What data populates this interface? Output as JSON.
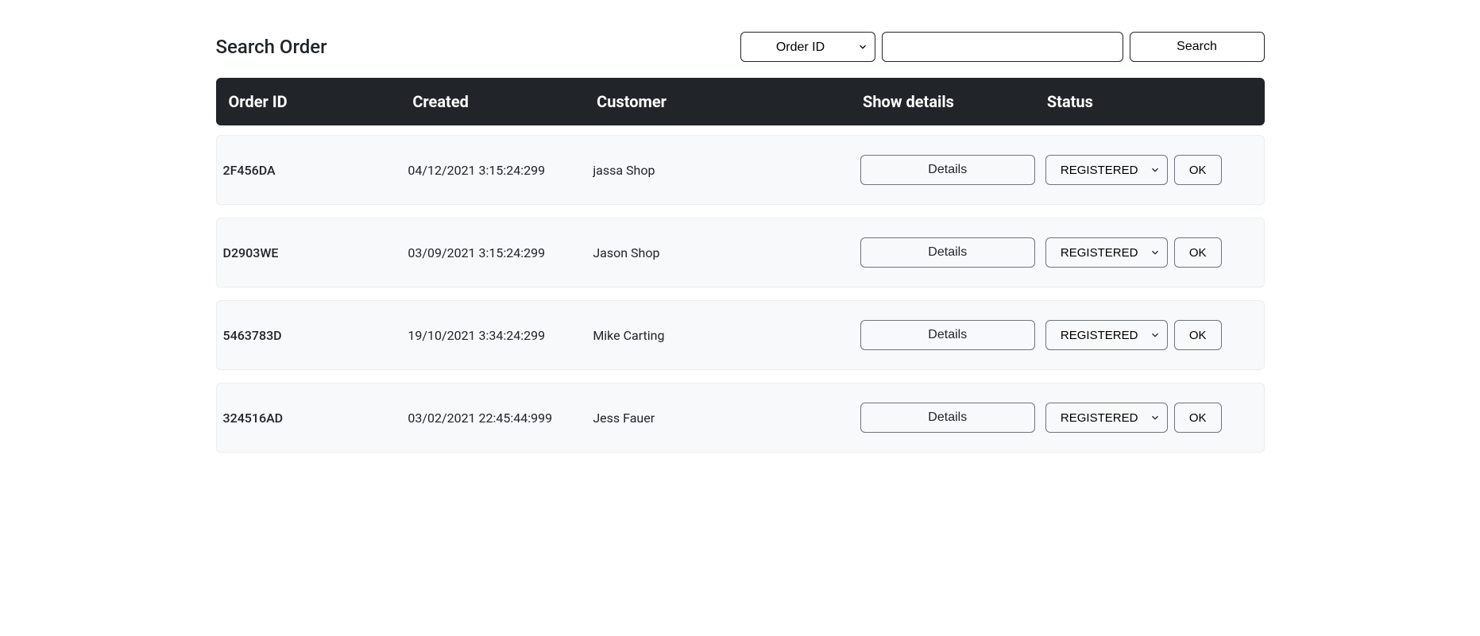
{
  "title": "Search Order",
  "search": {
    "field_option": "Order ID",
    "input_value": "",
    "button_label": "Search"
  },
  "columns": {
    "id": "Order ID",
    "created": "Created",
    "customer": "Customer",
    "details": "Show details",
    "status": "Status"
  },
  "labels": {
    "details_button": "Details",
    "ok_button": "OK"
  },
  "status_options": {
    "registered": "REGISTERED"
  },
  "orders": [
    {
      "id": "2F456DA",
      "created": "04/12/2021 3:15:24:299",
      "customer": "jassa Shop",
      "status": "REGISTERED"
    },
    {
      "id": "D2903WE",
      "created": "03/09/2021 3:15:24:299",
      "customer": "Jason Shop",
      "status": "REGISTERED"
    },
    {
      "id": "5463783D",
      "created": "19/10/2021 3:34:24:299",
      "customer": "Mike Carting",
      "status": "REGISTERED"
    },
    {
      "id": "324516AD",
      "created": "03/02/2021 22:45:44:999",
      "customer": "Jess Fauer",
      "status": "REGISTERED"
    }
  ]
}
